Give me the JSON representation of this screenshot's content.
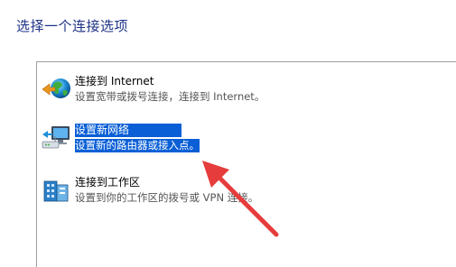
{
  "heading": "选择一个连接选项",
  "options": [
    {
      "title": "连接到 Internet",
      "description": "设置宽带或拨号连接，连接到 Internet。",
      "icon": "globe-network-icon",
      "selected": false
    },
    {
      "title": "设置新网络",
      "description": "设置新的路由器或接入点。",
      "icon": "router-monitor-icon",
      "selected": true
    },
    {
      "title": "连接到工作区",
      "description": "设置到你的工作区的拨号或 VPN 连接。",
      "icon": "workplace-building-icon",
      "selected": false
    }
  ],
  "colors": {
    "heading": "#1e3287",
    "selection": "#0a5fd6",
    "annotation_arrow": "#e63c3c"
  }
}
